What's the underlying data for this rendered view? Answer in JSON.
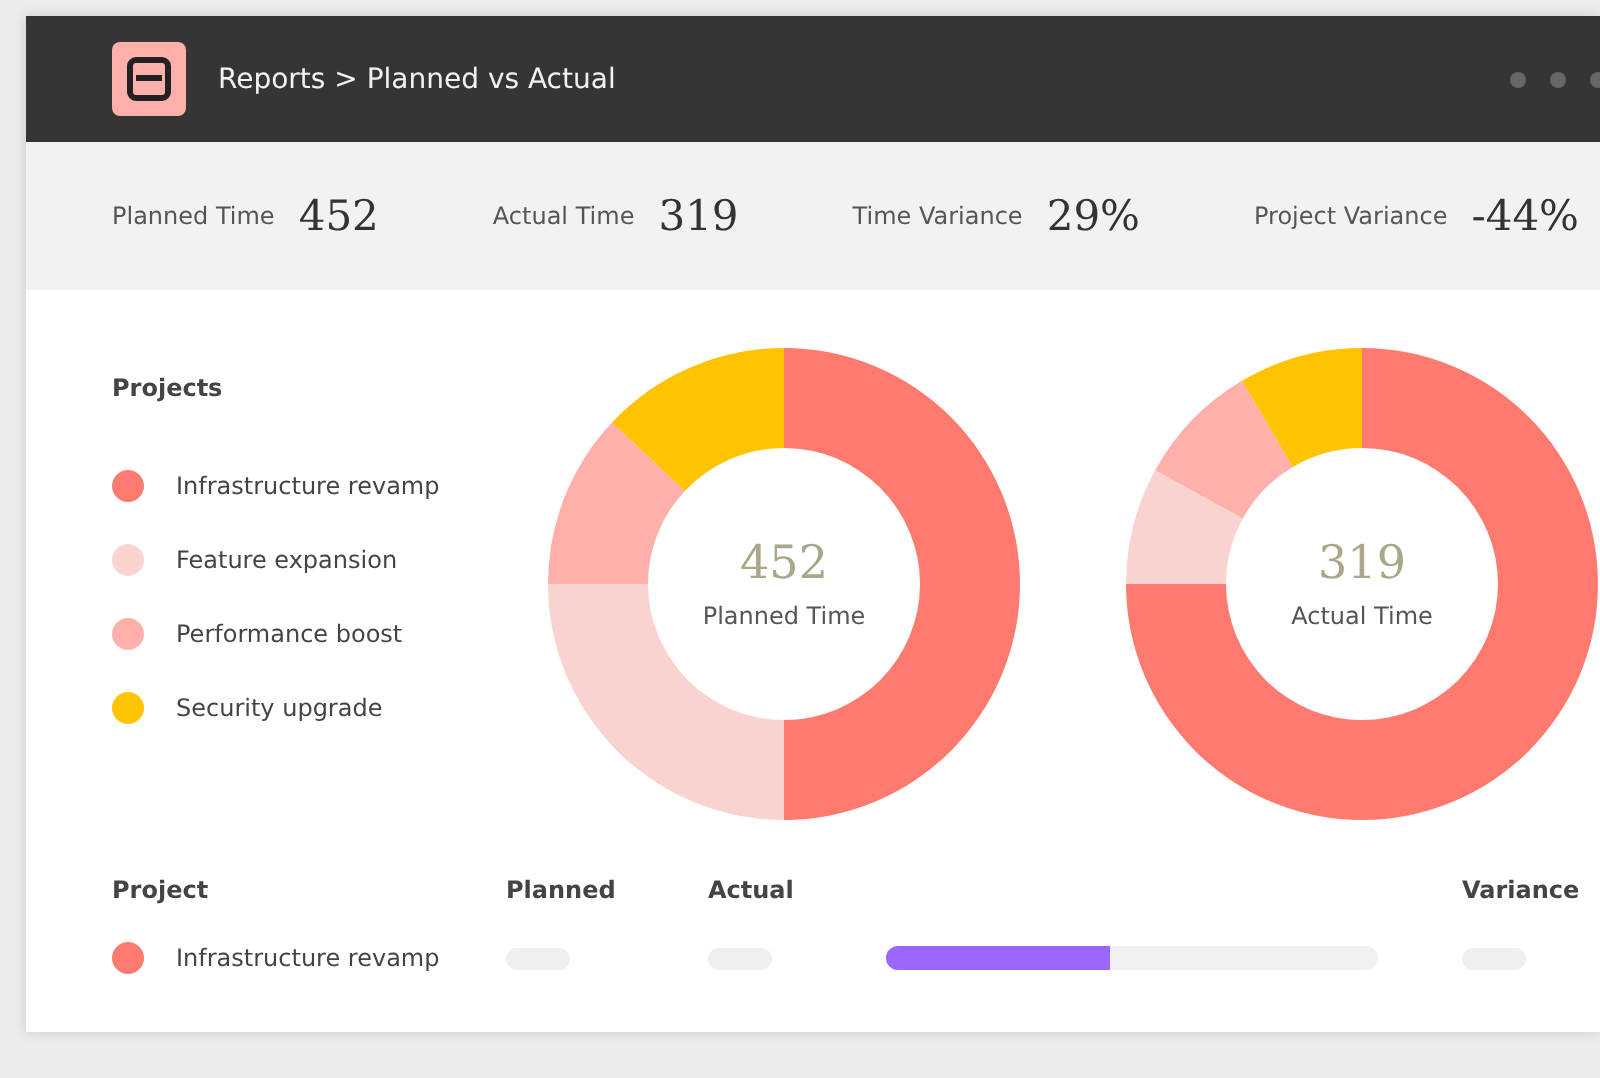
{
  "header": {
    "breadcrumb": "Reports > Planned vs Actual"
  },
  "stats": [
    {
      "label": "Planned Time",
      "value": "452"
    },
    {
      "label": "Actual Time",
      "value": "319"
    },
    {
      "label": "Time Variance",
      "value": "29%"
    },
    {
      "label": "Project Variance",
      "value": "-44%"
    }
  ],
  "legend": {
    "title": "Projects",
    "items": [
      {
        "name": "Infrastructure revamp",
        "color": "#ff7a6e"
      },
      {
        "name": "Feature expansion",
        "color": "#f9d3d0"
      },
      {
        "name": "Performance boost",
        "color": "#ffb0aa"
      },
      {
        "name": "Security upgrade",
        "color": "#ffc300"
      }
    ]
  },
  "donuts": [
    {
      "value": "452",
      "label": "Planned Time"
    },
    {
      "value": "319",
      "label": "Actual Time"
    }
  ],
  "table": {
    "columns": [
      "Project",
      "Planned",
      "Actual",
      "Variance"
    ],
    "rows": [
      {
        "project": "Infrastructure revamp",
        "color": "#ff7a6e",
        "level": 0.455
      }
    ]
  }
}
